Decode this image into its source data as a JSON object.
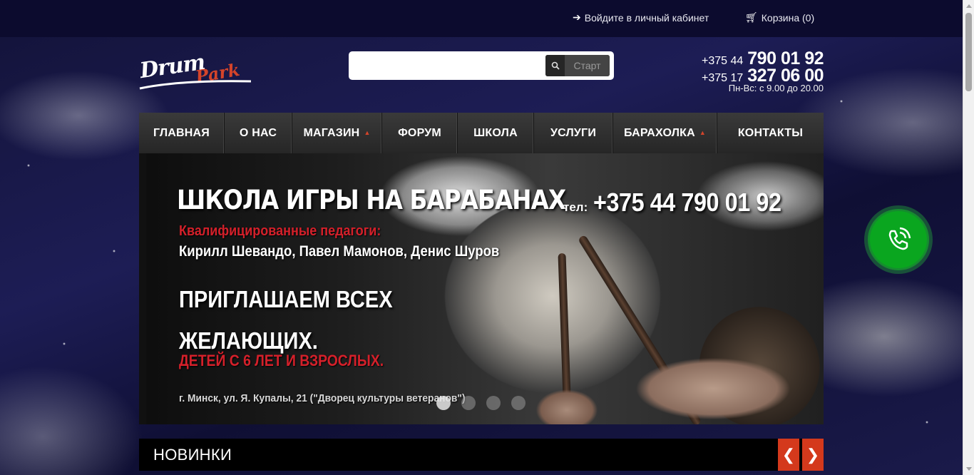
{
  "topbar": {
    "login_label": "Войдите в личный кабинет",
    "login_icon": "sign-in-icon",
    "cart_label": "Корзина (0)",
    "cart_icon": "cart-icon"
  },
  "logo": {
    "text_main": "Drum",
    "text_accent": "Park"
  },
  "search": {
    "value": "",
    "placeholder": "",
    "button_label": "Старт",
    "button_icon": "search-icon"
  },
  "contacts": {
    "phone1_prefix": "+375 44",
    "phone1_number": "790 01 92",
    "phone2_prefix": "+375 17",
    "phone2_number": "327 06 00",
    "hours": "Пн-Вс: с 9.00 до 20.00"
  },
  "nav": {
    "items": [
      {
        "label": "ГЛАВНАЯ"
      },
      {
        "label": "О НАС"
      },
      {
        "label": "МАГАЗИН"
      },
      {
        "label": "ФОРУМ"
      },
      {
        "label": "ШКОЛА"
      },
      {
        "label": "УСЛУГИ"
      },
      {
        "label": "БАРАХОЛКА"
      },
      {
        "label": "КОНТАКТЫ"
      }
    ]
  },
  "slide": {
    "title": "ШКОЛА ИГРЫ НА БАРАБАНАХ",
    "tel_prefix": "тел:",
    "tel_number": "+375 44 790 01 92",
    "teachers_heading": "Квалифицированные педагоги:",
    "teachers_names": "Кирилл Шевандо, Павел Мамонов, Денис Шуров",
    "invite_line1": "ПРИГЛАШАЕМ ВСЕХ",
    "invite_line2": "ЖЕЛАЮЩИХ.",
    "audience": "ДЕТЕЙ С 6 ЛЕТ И ВЗРОСЛЫХ.",
    "address": "г. Минск, ул. Я. Купалы, 21 (\"Дворец культуры ветеранов\")",
    "dots_count": 4,
    "active_dot": 1
  },
  "call_button": {
    "icon": "phone-icon"
  },
  "new_section": {
    "title": "НОВИНКИ",
    "prev_icon": "chevron-left-icon",
    "next_icon": "chevron-right-icon"
  },
  "colors": {
    "accent": "#d4391c",
    "call_green": "#0aa61f",
    "topbar_bg": "#0c0b2e"
  }
}
